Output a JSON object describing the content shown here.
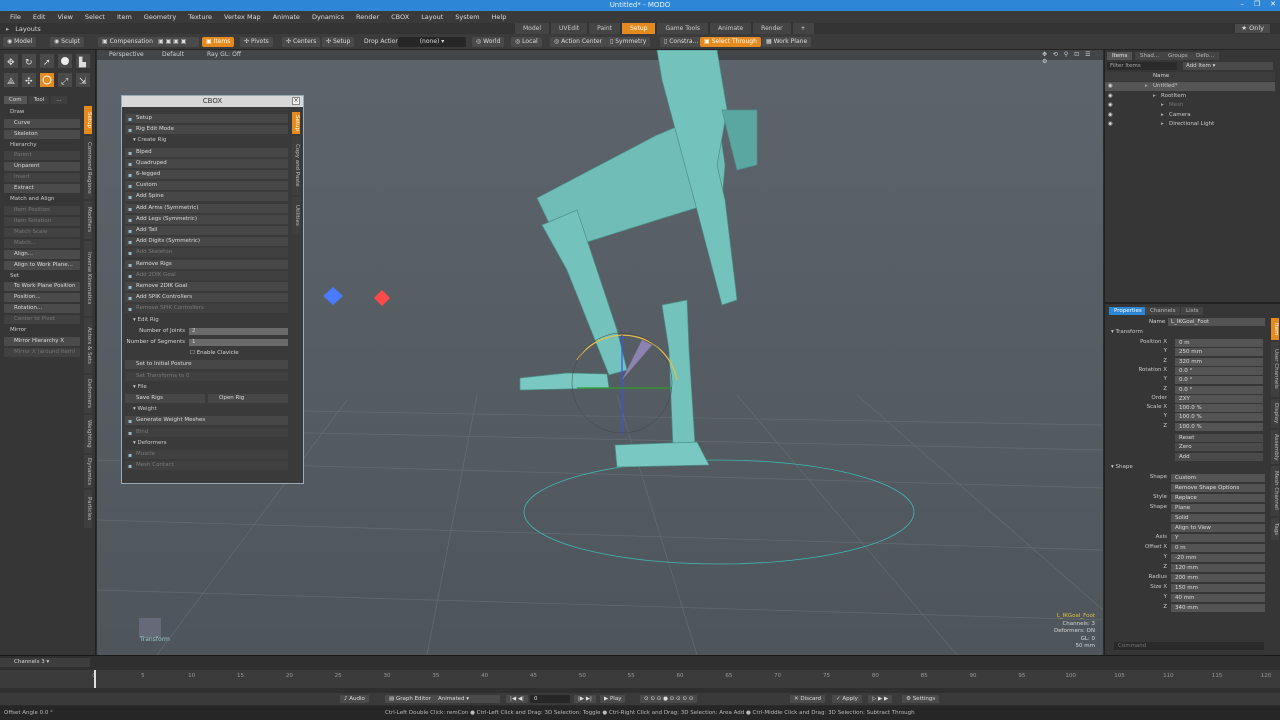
{
  "window": {
    "title": "Untitled* - MODO",
    "controls": [
      "–",
      "❐",
      "✕"
    ]
  },
  "menubar": [
    "File",
    "Edit",
    "View",
    "Select",
    "Item",
    "Geometry",
    "Texture",
    "Vertex Map",
    "Animate",
    "Dynamics",
    "Render",
    "CBOX",
    "Layout",
    "System",
    "Help"
  ],
  "layouts_label": "Layouts",
  "layout_tabs": [
    {
      "label": "Model"
    },
    {
      "label": "UVEdit"
    },
    {
      "label": "Paint"
    },
    {
      "label": "Setup",
      "active": true
    },
    {
      "label": "Game Tools"
    },
    {
      "label": "Animate"
    },
    {
      "label": "Render"
    },
    {
      "label": "+"
    }
  ],
  "only_label": "Only",
  "toolbar": {
    "model": "Model",
    "sculpt": "Sculpt",
    "compensation": "Compensation",
    "items": "Items",
    "pivots": "Pivots",
    "centers": "Centers",
    "setup": "Setup",
    "drop_action": "Drop Action",
    "drop_value": "(none)",
    "world": "World",
    "local": "Local",
    "action_center": "Action Center",
    "symmetry": "Symmetry",
    "constraints": "Constra...",
    "select_through": "Select Through",
    "work_plane": "Work Plane"
  },
  "left_panel": {
    "tabs": [
      "Com",
      "Tool",
      "..."
    ],
    "items": [
      {
        "type": "head",
        "label": "Draw"
      },
      {
        "type": "btn",
        "label": "Curve"
      },
      {
        "type": "btn",
        "label": "Skeleton"
      },
      {
        "type": "head",
        "label": "Hierarchy"
      },
      {
        "type": "btn",
        "label": "Parent",
        "dim": true
      },
      {
        "type": "btn",
        "label": "Unparent"
      },
      {
        "type": "btn",
        "label": "Insert",
        "dim": true
      },
      {
        "type": "btn",
        "label": "Extract"
      },
      {
        "type": "head",
        "label": "Match and Align"
      },
      {
        "type": "btn",
        "label": "Item Position",
        "dim": true
      },
      {
        "type": "btn",
        "label": "Item Rotation",
        "dim": true
      },
      {
        "type": "btn",
        "label": "Match Scale",
        "dim": true
      },
      {
        "type": "btn",
        "label": "Match...",
        "dim": true
      },
      {
        "type": "btn",
        "label": "Align..."
      },
      {
        "type": "btn",
        "label": "Align to Work Plane..."
      },
      {
        "type": "head",
        "label": "Set"
      },
      {
        "type": "btn",
        "label": "To Work Plane Position"
      },
      {
        "type": "btn",
        "label": "Position..."
      },
      {
        "type": "btn",
        "label": "Rotation..."
      },
      {
        "type": "btn",
        "label": "Center to Pivot",
        "dim": true
      },
      {
        "type": "head",
        "label": "Mirror"
      },
      {
        "type": "btn",
        "label": "Mirror Hierarchy X"
      },
      {
        "type": "btn",
        "label": "Mirror X (around item)",
        "dim": true
      }
    ],
    "vtabs": [
      "Setup",
      "Command Regions",
      "Modifiers",
      "Inverse Kinematics",
      "Actors & Sets",
      "Deformers",
      "Weighting",
      "Dynamics",
      "Particles"
    ]
  },
  "viewport": {
    "labels": {
      "perspective": "Perspective",
      "default": "Default",
      "raygl": "Ray GL: Off"
    },
    "transform_label": "Transform",
    "info": [
      "L_IKGoal_Foot",
      "Channels: 3",
      "Deformers: ON",
      "GL: 0",
      "50 mm"
    ]
  },
  "cbox": {
    "title": "CBOX",
    "vtabs": [
      "Setup",
      "Copy and Paste",
      "Utilities"
    ],
    "rows": [
      {
        "type": "row",
        "label": "Setup",
        "icon": "figure-icon"
      },
      {
        "type": "row",
        "label": "Rig Edit Mode",
        "icon": "checkbox-icon"
      },
      {
        "type": "head",
        "label": "Create Rig"
      },
      {
        "type": "row",
        "label": "Biped",
        "icon": "biped-icon"
      },
      {
        "type": "row",
        "label": "Quadruped",
        "icon": "quadruped-icon"
      },
      {
        "type": "row",
        "label": "6-legged",
        "icon": "insect-icon"
      },
      {
        "type": "row",
        "label": "Custom",
        "icon": "custom-icon"
      },
      {
        "type": "row",
        "label": "Add Spine",
        "icon": "spine-icon"
      },
      {
        "type": "row",
        "label": "Add Arms (Symmetric)",
        "icon": "arm-icon"
      },
      {
        "type": "row",
        "label": "Add Legs (Symmetric)",
        "icon": "leg-icon"
      },
      {
        "type": "row",
        "label": "Add Tail",
        "icon": "tail-icon"
      },
      {
        "type": "row",
        "label": "Add Digits (Symmetric)",
        "icon": "digits-icon"
      },
      {
        "type": "row",
        "label": "Add Skeleton",
        "icon": "skeleton-icon",
        "dim": true
      },
      {
        "type": "row",
        "label": "Remove Rigs",
        "icon": "remove-icon"
      },
      {
        "type": "row",
        "label": "Add 2DIK Goal",
        "icon": "ik-icon",
        "dim": true
      },
      {
        "type": "row",
        "label": "Remove 2DIK Goal",
        "icon": "ik-remove-icon"
      },
      {
        "type": "row",
        "label": "Add SPIK Controllers",
        "icon": "spik-icon"
      },
      {
        "type": "row",
        "label": "Remove SPIK Controllers",
        "icon": "spik-remove-icon",
        "dim": true
      },
      {
        "type": "head",
        "label": "Edit Rig"
      },
      {
        "type": "field",
        "label": "Number of Joints",
        "value": "2"
      },
      {
        "type": "field",
        "label": "Number of Segments",
        "value": "1"
      },
      {
        "type": "check",
        "label": "Enable Clavicle"
      },
      {
        "type": "row",
        "label": "Set to Initial Posture",
        "icon": ""
      },
      {
        "type": "row",
        "label": "Set Transforms to 0",
        "icon": "",
        "dim": true
      },
      {
        "type": "head",
        "label": "File"
      },
      {
        "type": "pair",
        "labels": [
          "Save Rigs",
          "Open Rig"
        ]
      },
      {
        "type": "head",
        "label": "Weight"
      },
      {
        "type": "row",
        "label": "Generate Weight Meshes",
        "icon": "weight-icon"
      },
      {
        "type": "row",
        "label": "Bind",
        "icon": "bind-icon",
        "dim": true
      },
      {
        "type": "head",
        "label": "Deformers"
      },
      {
        "type": "row",
        "label": "Muscle",
        "icon": "muscle-icon",
        "dim": true
      },
      {
        "type": "row",
        "label": "Mesh Contact",
        "icon": "contact-icon",
        "dim": true
      }
    ]
  },
  "right_panel": {
    "tabs": [
      "Items",
      "Shad...",
      "Groups",
      "Defo..."
    ],
    "filter_label": "Filter Items",
    "add_item": "Add Item",
    "tree_header": "Name",
    "tree": [
      {
        "label": "Untitled*",
        "indent": 0,
        "selected": true
      },
      {
        "label": "RootItem",
        "indent": 1
      },
      {
        "label": "Mesh",
        "indent": 2,
        "dim": true
      },
      {
        "label": "Camera",
        "indent": 2
      },
      {
        "label": "Directional Light",
        "indent": 2
      }
    ],
    "prop_tabs": [
      "Properties",
      "Channels",
      "Lists"
    ],
    "name_label": "Name",
    "name_value": "L_IKGoal_Foot",
    "transform_head": "Transform",
    "props": [
      {
        "label": "Position X",
        "value": "0 m"
      },
      {
        "label": "Y",
        "value": "250 mm"
      },
      {
        "label": "Z",
        "value": "320 mm"
      },
      {
        "label": "Rotation X",
        "value": "0.0 °"
      },
      {
        "label": "Y",
        "value": "0.0 °"
      },
      {
        "label": "Z",
        "value": "0.0 °"
      },
      {
        "label": "Order",
        "value": "ZXY"
      },
      {
        "label": "Scale X",
        "value": "100.0 %"
      },
      {
        "label": "Y",
        "value": "100.0 %"
      },
      {
        "label": "Z",
        "value": "100.0 %"
      }
    ],
    "buttons": [
      "Reset",
      "Zero",
      "Add"
    ],
    "shape_head": "Shape",
    "shape_props": [
      {
        "label": "Shape",
        "value": "Custom"
      },
      {
        "label": "",
        "value": "Remove Shape Options"
      },
      {
        "label": "Style",
        "value": "Replace"
      },
      {
        "label": "Shape",
        "value": "Plane"
      },
      {
        "label": "",
        "value": "Solid"
      },
      {
        "label": "",
        "value": "Align to View"
      },
      {
        "label": "Axis",
        "value": "Y"
      },
      {
        "label": "Offset X",
        "value": "0 m"
      },
      {
        "label": "Y",
        "value": "-20 mm"
      },
      {
        "label": "Z",
        "value": "120 mm"
      },
      {
        "label": "Radius",
        "value": "200 mm"
      },
      {
        "label": "Size X",
        "value": "150 mm"
      },
      {
        "label": "Y",
        "value": "40 mm"
      },
      {
        "label": "Z",
        "value": "340 mm"
      }
    ],
    "vtabs": [
      "Item",
      "User Channels",
      "Display",
      "Assembly",
      "Mesh Channel",
      "Tags"
    ],
    "command_placeholder": "Command"
  },
  "timeline": {
    "channels_label": "Channels 3",
    "ticks": [
      "0",
      "5",
      "10",
      "15",
      "20",
      "25",
      "30",
      "35",
      "40",
      "45",
      "50",
      "55",
      "60",
      "65",
      "70",
      "75",
      "80",
      "85",
      "90",
      "95",
      "100",
      "105",
      "110",
      "115",
      "120"
    ]
  },
  "bottom_bar": {
    "audio": "Audio",
    "graph_editor": "Graph Editor",
    "animated": "Animated",
    "frame": "0",
    "play": "Play",
    "discard": "Discard",
    "apply": "Apply",
    "settings": "Settings"
  },
  "status": {
    "left": "Offset Angle 0.0 °",
    "hint": "Ctrl-Left Double Click: remCon ● Ctrl-Left Click and Drag: 3D Selection: Toggle ● Ctrl-Right Click and Drag: 3D Selection: Area Add ● Ctrl-Middle Click and Drag: 3D Selection: Subtract Through"
  }
}
